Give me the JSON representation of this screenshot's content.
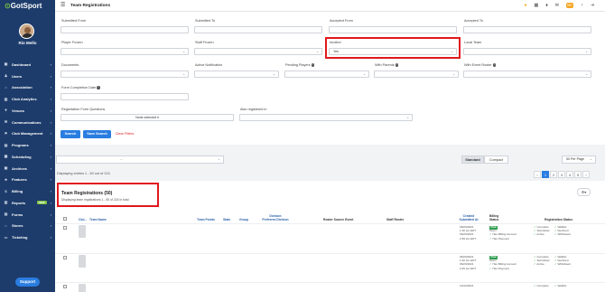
{
  "app": {
    "logo": "GotSport",
    "user_name": "Rio Mello"
  },
  "sidebar": {
    "items": [
      {
        "label": "Dashboard",
        "icon": "dashboard-icon"
      },
      {
        "label": "Users",
        "icon": "users-icon"
      },
      {
        "label": "Association",
        "icon": "association-icon"
      },
      {
        "label": "Club Analytics",
        "icon": "analytics-icon"
      },
      {
        "label": "Venues",
        "icon": "venues-icon"
      },
      {
        "label": "Communications",
        "icon": "communications-icon"
      },
      {
        "label": "Club Management",
        "icon": "club-management-icon"
      },
      {
        "label": "Programs",
        "icon": "programs-icon"
      },
      {
        "label": "Scheduling",
        "icon": "scheduling-icon"
      },
      {
        "label": "Archives",
        "icon": "archives-icon"
      },
      {
        "label": "Features",
        "icon": "features-icon"
      },
      {
        "label": "Billing",
        "icon": "billing-icon"
      },
      {
        "label": "Reports",
        "icon": "reports-icon",
        "badge": "NEW"
      },
      {
        "label": "Forms",
        "icon": "forms-icon"
      },
      {
        "label": "Stores",
        "icon": "stores-icon"
      },
      {
        "label": "Ticketing",
        "icon": "ticketing-icon"
      }
    ],
    "support_label": "Support"
  },
  "topbar": {
    "title": "Team Registrations",
    "notification_count": "99+"
  },
  "filters": {
    "submitted_from": "Submitted From",
    "submitted_to": "Submitted To",
    "accepted_from": "Accepted From",
    "accepted_to": "Accepted To",
    "player_frozen": "Player Frozen",
    "staff_frozen": "Staff Frozen",
    "inrolled": "Inrolled",
    "inrolled_value": "Yes",
    "local_team": "Local Team",
    "documents": "Documents",
    "active_notification": "Active Notification",
    "pending_players": "Pending Players",
    "with_parents": "With Parents",
    "with_event_roster": "With Event Roster",
    "form_completion_date": "Form Completion Date",
    "registration_form_questions": "Registration Form Questions",
    "none_selected": "None selected",
    "also_registered_in": "Also registered in",
    "search_label": "Search",
    "save_search_label": "Save Search",
    "clear_filters_label": "Clear Filters"
  },
  "toolbar": {
    "event_select_value": "...",
    "view_standard": "Standard",
    "view_compact": "Compact",
    "per_page": "50 Per Page",
    "entries_text": "Displaying entries 1 - 50 out of 224",
    "pages": [
      "‹",
      "1",
      "2",
      "3",
      "4",
      "5",
      "›"
    ],
    "active_page": "1"
  },
  "table": {
    "title": "Team Registrations (50)",
    "subtitle": "Displaying team registrations 1 - 50 of 224 in total",
    "headers": {
      "club": "Clul...",
      "team_name": "Team Name",
      "team_points": "Team Points",
      "state": "State",
      "group": "Group",
      "division": "Division\nPreferred Division",
      "roster_source_event": "Roster Source Event",
      "staff_roster": "Staff Roster",
      "created": "Created\nSubmitted At",
      "billing": "Billing\nStatus",
      "registration_status": "Registration Status"
    },
    "rows": [
      {
        "created": "06/23/2021",
        "created_time": "1:32 pm EDT",
        "submitted": "06/23/2021",
        "submitted_time": "2:49 pm EDT",
        "billing_tag": "Paid",
        "billing_label": "Team",
        "billing_lines": [
          "Has Billing Account",
          "Has Payment"
        ],
        "status_left": [
          "Complete",
          "Submitted",
          "Active"
        ],
        "status_right": [
          "Waitlist",
          "Declined",
          "Withdrawn"
        ]
      },
      {
        "created": "06/23/2021",
        "created_time": "1:32 pm EDT",
        "submitted": "06/23/2021",
        "submitted_time": "2:49 pm EDT",
        "billing_tag": "Paid",
        "billing_label": "Team",
        "billing_lines": [
          "Has Billing Account",
          "Has Payment"
        ],
        "status_left": [
          "Complete",
          "Submitted",
          "Active"
        ],
        "status_right": [
          "Waitlist",
          "Declined",
          "Withdrawn"
        ]
      },
      {
        "created": "10/12/2021",
        "created_time": "",
        "submitted": "",
        "submitted_time": "",
        "billing_tag": "",
        "billing_label": "",
        "billing_lines": [],
        "status_left": [
          "Complete"
        ],
        "status_right": [
          "Waitlist"
        ]
      }
    ]
  },
  "colors": {
    "sidebar": "#1d3c6b",
    "accent": "#2a7de1",
    "highlight": "#e0181b",
    "success": "#2e9e4f"
  }
}
